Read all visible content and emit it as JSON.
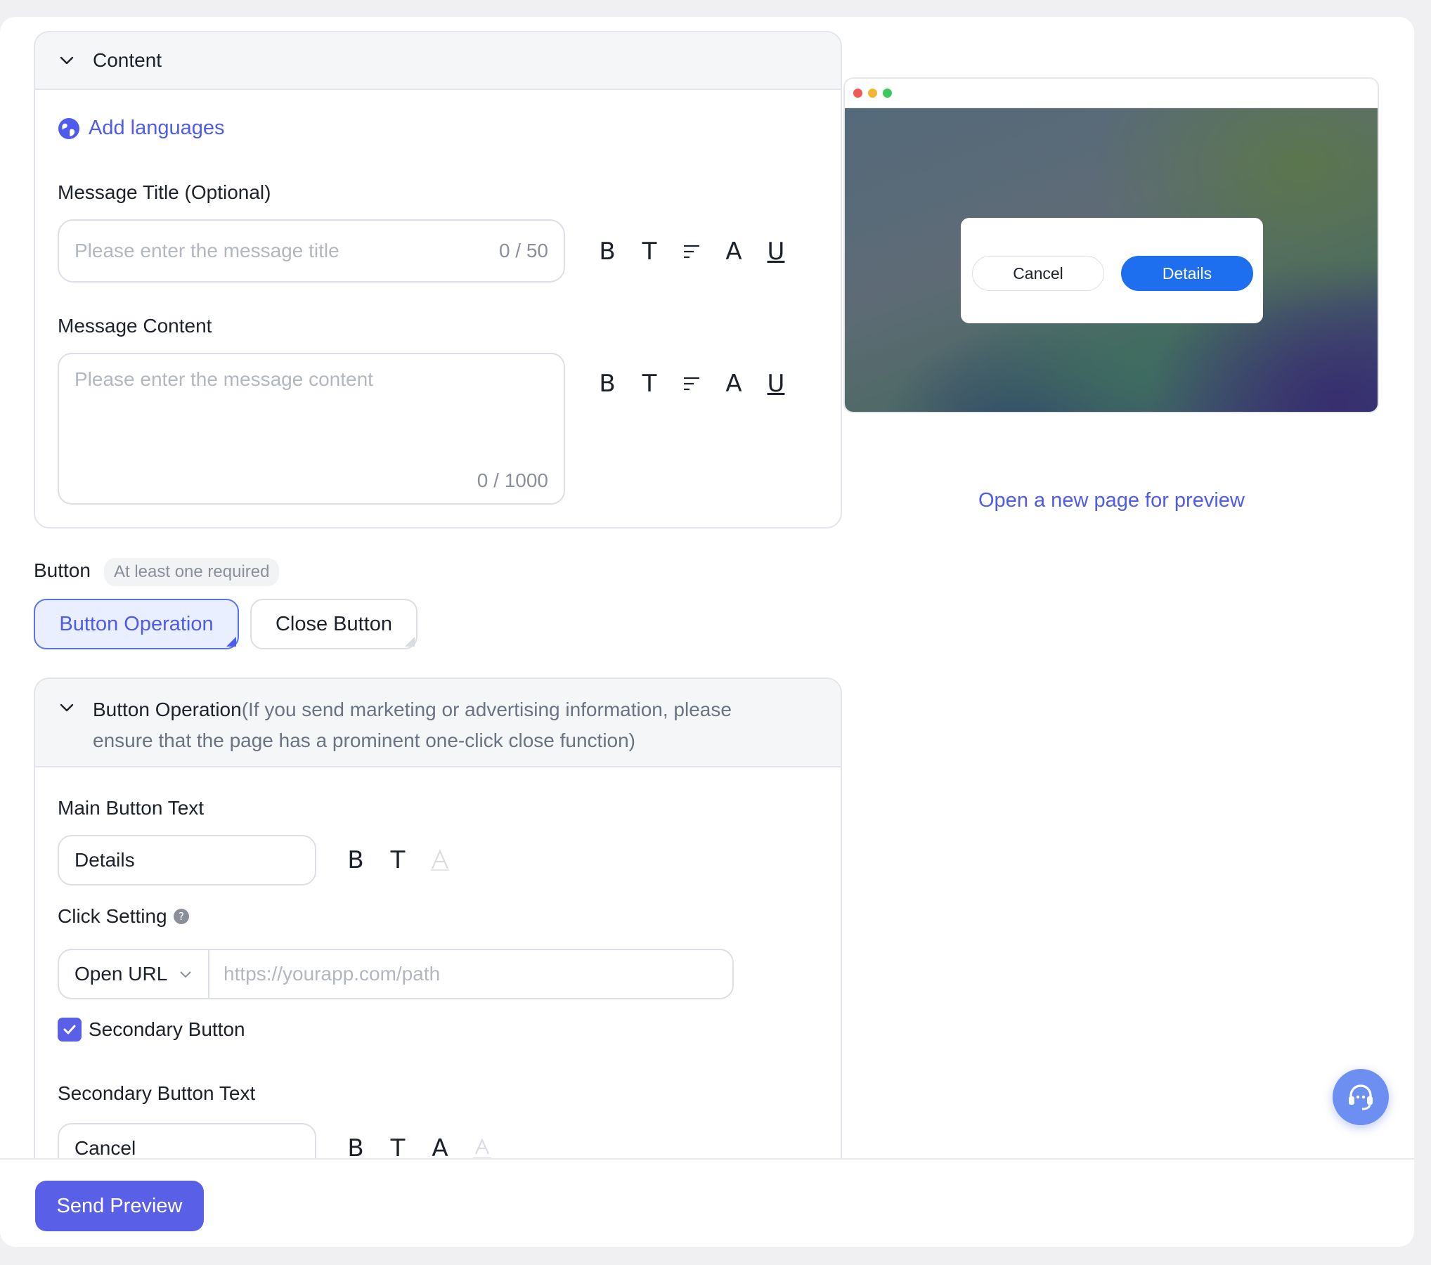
{
  "content_panel": {
    "title": "Content",
    "add_languages": "Add languages",
    "message_title": {
      "label": "Message Title (Optional)",
      "placeholder": "Please enter the message title",
      "counter": "0 / 50"
    },
    "message_content": {
      "label": "Message Content",
      "placeholder": "Please enter the message content",
      "counter": "0 / 1000"
    },
    "format_tools": [
      "B",
      "T",
      "☰",
      "A",
      "U"
    ]
  },
  "button_section": {
    "label": "Button",
    "requirement_tag": "At least one required",
    "options": [
      {
        "label": "Button Operation",
        "selected": true
      },
      {
        "label": "Close Button",
        "selected": false
      }
    ]
  },
  "button_operation_panel": {
    "title": "Button Operation",
    "hint_line1": "(If you send marketing or advertising information, please",
    "hint_line2": "ensure that the page has a prominent one-click close function)",
    "main_button_text": {
      "label": "Main Button Text",
      "value": "Details"
    },
    "click_setting": {
      "label": "Click Setting",
      "action": "Open URL",
      "url_placeholder": "https://yourapp.com/path"
    },
    "secondary_button": {
      "checkbox_label": "Secondary Button",
      "checked": true,
      "text_label": "Secondary Button Text",
      "value": "Cancel"
    }
  },
  "preview": {
    "dialog_cancel": "Cancel",
    "dialog_details": "Details",
    "open_new_page": "Open a new page for preview"
  },
  "footer": {
    "send_preview": "Send Preview"
  },
  "colors": {
    "accent": "#5a5fe8",
    "link": "#4f5bea",
    "preview_primary": "#1e6ff0"
  }
}
